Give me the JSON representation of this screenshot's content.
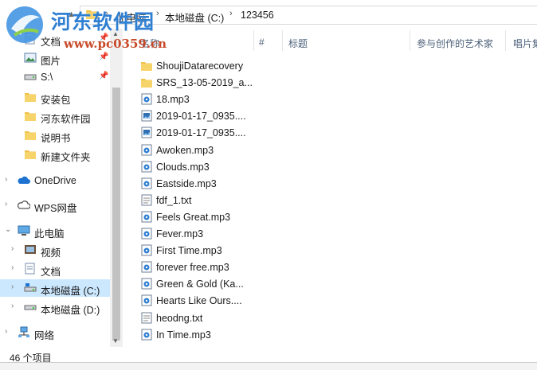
{
  "watermark": {
    "title": "河东软件园",
    "url": "www.pc0359.cn"
  },
  "address_bar": {
    "crumbs": [
      "此电脑",
      "本地磁盘 (C:)",
      "123456"
    ]
  },
  "nav": {
    "items": [
      {
        "label": "文档",
        "icon": "documents-icon",
        "pinned": true
      },
      {
        "label": "图片",
        "icon": "pictures-icon",
        "pinned": true
      },
      {
        "label": "S:\\",
        "icon": "drive-icon",
        "pinned": true
      },
      {
        "label": "安装包",
        "icon": "folder-icon"
      },
      {
        "label": "河东软件园",
        "icon": "folder-icon"
      },
      {
        "label": "说明书",
        "icon": "folder-icon"
      },
      {
        "label": "新建文件夹",
        "icon": "folder-icon"
      },
      {
        "label": "OneDrive",
        "icon": "cloud-icon"
      },
      {
        "label": "WPS网盘",
        "icon": "cloud-outline-icon"
      },
      {
        "label": "此电脑",
        "icon": "computer-icon"
      },
      {
        "label": "视频",
        "icon": "video-icon"
      },
      {
        "label": "文档",
        "icon": "documents-icon"
      },
      {
        "label": "本地磁盘 (C:)",
        "icon": "drive-c-icon",
        "selected": true
      },
      {
        "label": "本地磁盘 (D:)",
        "icon": "drive-icon"
      },
      {
        "label": "网络",
        "icon": "network-icon"
      }
    ]
  },
  "columns": {
    "name": "名称",
    "number": "#",
    "title": "标题",
    "artist": "参与创作的艺术家",
    "album": "唱片集"
  },
  "files": [
    {
      "name": "ShoujiDatarecovery",
      "type": "folder"
    },
    {
      "name": "SRS_13-05-2019_a...",
      "type": "folder"
    },
    {
      "name": "18.mp3",
      "type": "mp3"
    },
    {
      "name": "2019-01-17_0935....",
      "type": "image"
    },
    {
      "name": "2019-01-17_0935....",
      "type": "image"
    },
    {
      "name": "Awoken.mp3",
      "type": "mp3"
    },
    {
      "name": "Clouds.mp3",
      "type": "mp3"
    },
    {
      "name": "Eastside.mp3",
      "type": "mp3"
    },
    {
      "name": "fdf_1.txt",
      "type": "txt"
    },
    {
      "name": "Feels Great.mp3",
      "type": "mp3"
    },
    {
      "name": "Fever.mp3",
      "type": "mp3"
    },
    {
      "name": "First Time.mp3",
      "type": "mp3"
    },
    {
      "name": "forever free.mp3",
      "type": "mp3"
    },
    {
      "name": "Green & Gold (Ka...",
      "type": "mp3"
    },
    {
      "name": "Hearts Like Ours....",
      "type": "mp3"
    },
    {
      "name": "heodng.txt",
      "type": "txt"
    },
    {
      "name": "In Time.mp3",
      "type": "mp3"
    }
  ],
  "status": {
    "count": "46 个项目"
  },
  "colors": {
    "selected": "#cce8ff",
    "folder": "#f0c24b",
    "accent": "#2f7fd2"
  }
}
